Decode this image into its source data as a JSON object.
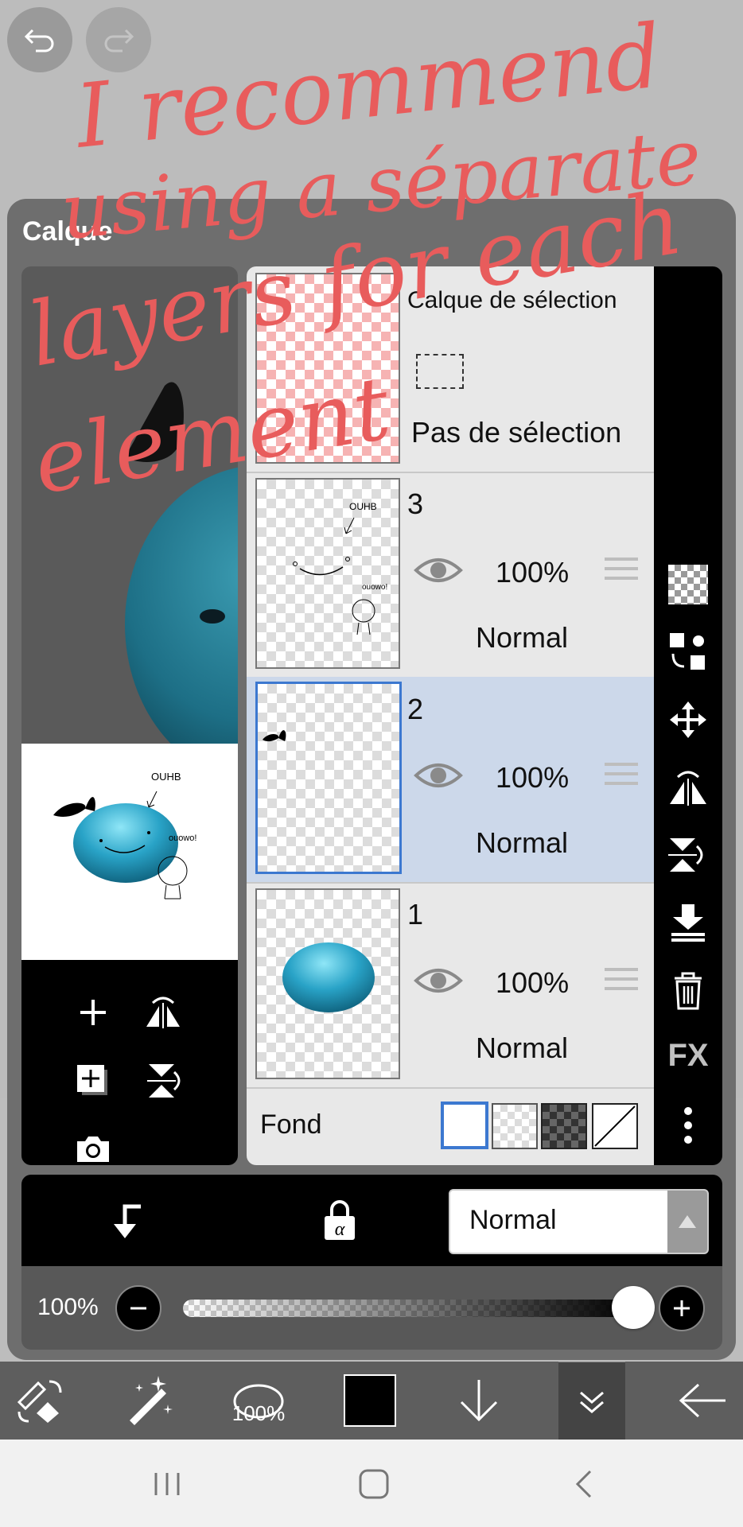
{
  "panel": {
    "title": "Calque"
  },
  "layers": [
    {
      "name": "Calque de sélection",
      "status": "Pas de sélection"
    },
    {
      "name": "3",
      "opacity": "100%",
      "mode": "Normal",
      "thumb_text_1": "OUHB",
      "thumb_text_2": "ouowo!"
    },
    {
      "name": "2",
      "opacity": "100%",
      "mode": "Normal",
      "selected": true
    },
    {
      "name": "1",
      "opacity": "100%",
      "mode": "Normal"
    }
  ],
  "background": {
    "label": "Fond"
  },
  "preview": {
    "text_1": "OUHB",
    "text_2": "ouowo!"
  },
  "blend_mode": {
    "selected": "Normal"
  },
  "opacity": {
    "value_label": "100%",
    "value": 1.0
  },
  "toolbar": {
    "brush_opacity": "100%",
    "color": "#000000"
  },
  "sidebar": {
    "fx_label": "FX"
  },
  "annotation": {
    "line1": "I recommend",
    "line2": "using a séparate",
    "line3": "layers for each",
    "line4": "element"
  },
  "colors": {
    "accent": "#3c78d0",
    "selected_row": "#ccd8ea",
    "annotation": "#e85c5c",
    "blob": "#29a3c7"
  }
}
